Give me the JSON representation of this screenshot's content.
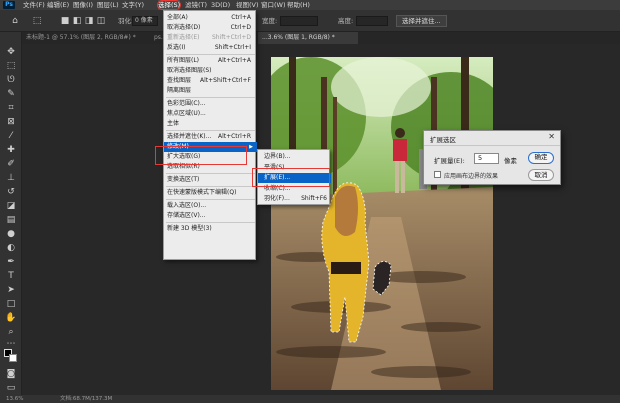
{
  "menubar": {
    "logo": "Ps",
    "items": [
      "文件(F)",
      "编辑(E)",
      "图像(I)",
      "图层(L)",
      "文字(Y)",
      "选择(S)",
      "滤镜(T)",
      "3D(D)",
      "视图(V)",
      "窗口(W)",
      "帮助(H)"
    ],
    "active_index": 5
  },
  "options": {
    "feather_label": "羽化:",
    "feather_value": "0 像素",
    "width_label": "宽度:",
    "height_label": "高度:",
    "select_mask_button": "选择并遮住..."
  },
  "tabs": [
    {
      "label": "未标题-1 @ 57.1% (图层 2, RGB/8#) *",
      "active": false
    },
    {
      "label": "ps...",
      "active": false
    },
    {
      "label": "...3.6% (图层 1, RGB/8) *",
      "active": true
    }
  ],
  "select_menu": {
    "items": [
      {
        "label": "全部(A)",
        "shortcut": "Ctrl+A",
        "dim": false
      },
      {
        "label": "取消选择(D)",
        "shortcut": "Ctrl+D",
        "dim": false
      },
      {
        "label": "重新选择(E)",
        "shortcut": "Shift+Ctrl+D",
        "dim": true
      },
      {
        "label": "反选(I)",
        "shortcut": "Shift+Ctrl+I",
        "dim": false
      },
      {
        "sep": true
      },
      {
        "label": "所有图层(L)",
        "shortcut": "Alt+Ctrl+A",
        "dim": false
      },
      {
        "label": "取消选择图层(S)",
        "shortcut": "",
        "dim": false
      },
      {
        "label": "查找图层",
        "shortcut": "Alt+Shift+Ctrl+F",
        "dim": false
      },
      {
        "label": "隔离图层",
        "shortcut": "",
        "dim": false
      },
      {
        "sep": true
      },
      {
        "label": "色彩范围(C)...",
        "shortcut": "",
        "dim": false
      },
      {
        "label": "焦点区域(U)...",
        "shortcut": "",
        "dim": false
      },
      {
        "label": "主体",
        "shortcut": "",
        "dim": false
      },
      {
        "sep": true
      },
      {
        "label": "选择并遮住(K)...",
        "shortcut": "Alt+Ctrl+R",
        "dim": false
      },
      {
        "label": "修改(M)",
        "shortcut": "",
        "dim": false,
        "highlight": true,
        "submenu": true
      },
      {
        "label": "扩大选取(G)",
        "shortcut": "",
        "dim": false
      },
      {
        "label": "选取相似(R)",
        "shortcut": "",
        "dim": false
      },
      {
        "sep": true
      },
      {
        "label": "变换选区(T)",
        "shortcut": "",
        "dim": false
      },
      {
        "sep": true
      },
      {
        "label": "在快速蒙版模式下编辑(Q)",
        "shortcut": "",
        "dim": false
      },
      {
        "sep": true
      },
      {
        "label": "载入选区(O)...",
        "shortcut": "",
        "dim": false
      },
      {
        "label": "存储选区(V)...",
        "shortcut": "",
        "dim": false
      },
      {
        "sep": true
      },
      {
        "label": "新建 3D 模型(3)",
        "shortcut": "",
        "dim": false
      }
    ]
  },
  "modify_submenu": {
    "items": [
      {
        "label": "边界(B)...",
        "shortcut": ""
      },
      {
        "label": "平滑(S)...",
        "shortcut": ""
      },
      {
        "label": "扩展(E)...",
        "shortcut": "",
        "highlight": true
      },
      {
        "label": "收缩(C)...",
        "shortcut": ""
      },
      {
        "label": "羽化(F)...",
        "shortcut": "Shift+F6"
      }
    ]
  },
  "dialog": {
    "title": "扩展选区",
    "expand_label": "扩展量(E):",
    "expand_value": "5",
    "unit": "像素",
    "checkbox_label": "应用画布边界的效果",
    "checkbox_checked": false,
    "ok_label": "确定",
    "cancel_label": "取消"
  },
  "status": {
    "zoom": "13.6%",
    "doc": "文档:68.7M/137.3M"
  },
  "colors": {
    "highlight": "#0a64c8",
    "annotation_red": "#e53935"
  }
}
